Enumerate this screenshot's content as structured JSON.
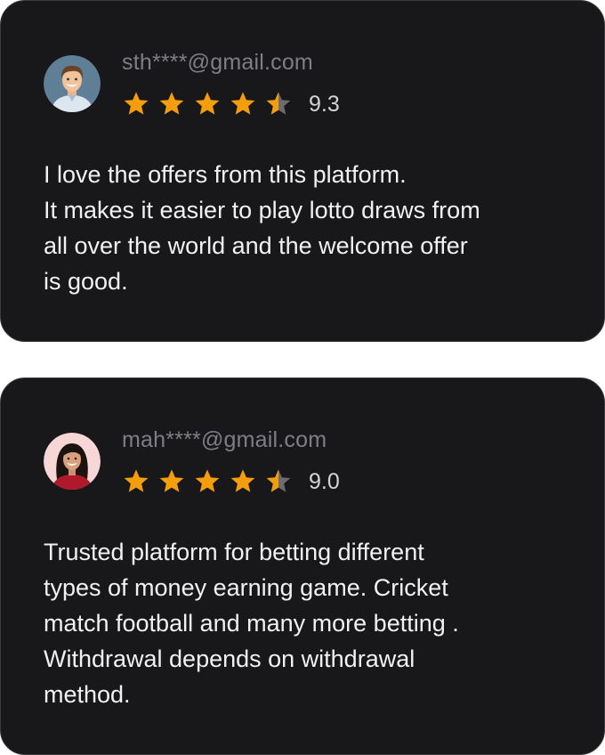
{
  "reviews": [
    {
      "email": "sth****@gmail.com",
      "score": "9.3",
      "stars": 4.5,
      "avatar": "man-avatar",
      "text_lines": [
        "I love the offers from this platform.",
        "It makes it easier to play lotto draws from",
        "all over the world and the welcome offer",
        "is good."
      ]
    },
    {
      "email": "mah****@gmail.com",
      "score": "9.0",
      "stars": 4.5,
      "avatar": "woman-avatar",
      "text_lines": [
        "Trusted platform for betting different",
        "types of money earning game. Cricket",
        "match football and many more betting .",
        "Withdrawal depends on withdrawal",
        "method."
      ]
    }
  ],
  "colors": {
    "card_bg": "#18181b",
    "star_filled": "#f59e0b",
    "star_empty": "#6b6b70",
    "email": "#7e7e86",
    "text": "#f1f1f3"
  },
  "icons": {
    "star": "star-icon",
    "half_star": "half-star-icon"
  }
}
